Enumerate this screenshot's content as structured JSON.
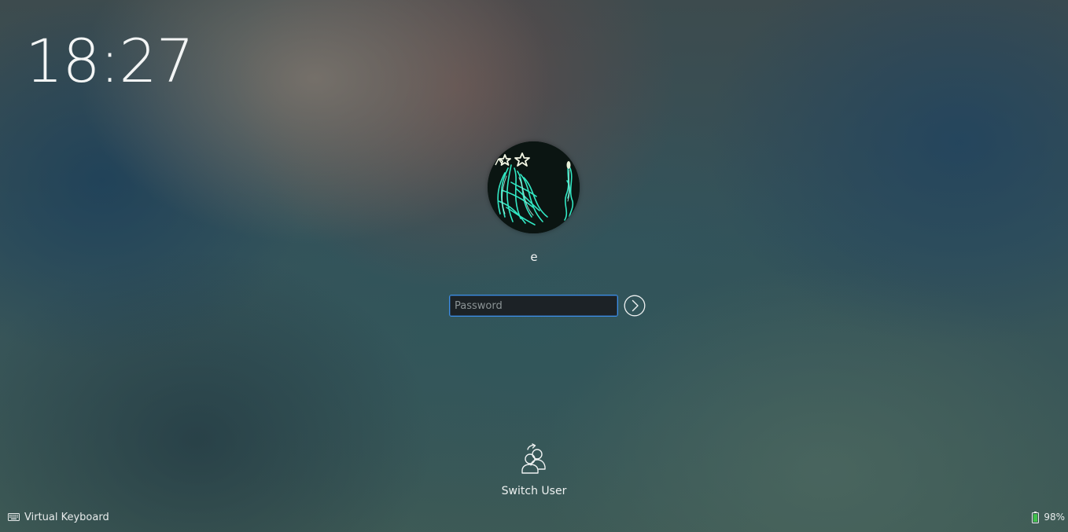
{
  "clock": {
    "time": "18:27"
  },
  "user": {
    "name": "e",
    "avatar_icon": "user-avatar-image"
  },
  "login": {
    "password_placeholder": "Password",
    "password_value": "",
    "submit_icon": "arrow-right-circle-icon"
  },
  "actions": {
    "switch_user_label": "Switch User",
    "switch_user_icon": "switch-user-icon"
  },
  "footer": {
    "virtual_keyboard_label": "Virtual Keyboard",
    "keyboard_icon": "keyboard-icon",
    "battery_percent": "98%",
    "battery_icon": "battery-icon",
    "battery_level": 0.98
  },
  "colors": {
    "accent": "#3d8ee8",
    "battery_fill": "#3fbf4a",
    "avatar_glow": "#2fe6c2"
  }
}
